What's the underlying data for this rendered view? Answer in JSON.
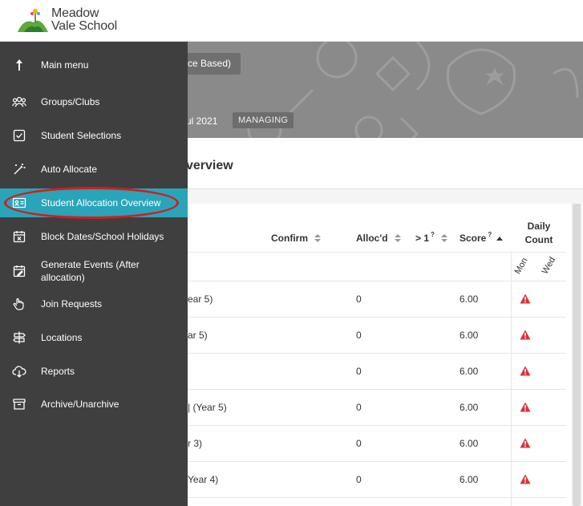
{
  "logo": {
    "line1": "Meadow",
    "line2": "Vale School"
  },
  "banner": {
    "button_label": "ce Based)",
    "date_text": "ul 2021",
    "badge": "MANAGING"
  },
  "page": {
    "title": "verview"
  },
  "table": {
    "columns": {
      "confirm": "Confirm",
      "allocd": "Alloc'd",
      "gt1": "> 1",
      "gt1_sup": "?",
      "score": "Score",
      "score_sup": "?",
      "daily": "Daily",
      "daily2": "Count"
    },
    "days": [
      "Mon",
      "Wed"
    ],
    "rows": [
      {
        "name": "ear 5)",
        "allocd": "0",
        "score": "6.00"
      },
      {
        "name": "ar 5)",
        "allocd": "0",
        "score": "6.00"
      },
      {
        "name": "",
        "allocd": "0",
        "score": "6.00"
      },
      {
        "name": "| (Year 5)",
        "allocd": "0",
        "score": "6.00"
      },
      {
        "name": "r 3)",
        "allocd": "0",
        "score": "6.00"
      },
      {
        "name": "Year 4)",
        "allocd": "0",
        "score": "6.00"
      }
    ]
  },
  "sidebar": {
    "items": [
      {
        "label": "Main menu",
        "icon": "arrow-up-icon"
      },
      {
        "label": "Groups/Clubs",
        "icon": "people-icon"
      },
      {
        "label": "Student Selections",
        "icon": "checkbox-icon"
      },
      {
        "label": "Auto Allocate",
        "icon": "magic-wand-icon"
      },
      {
        "label": "Student Allocation Overview",
        "icon": "id-card-icon"
      },
      {
        "label": "Block Dates/School Holidays",
        "icon": "calendar-x-icon"
      },
      {
        "label": "Generate Events (After",
        "label2": "allocation)",
        "icon": "calendar-edit-icon"
      },
      {
        "label": "Join Requests",
        "icon": "hand-icon"
      },
      {
        "label": "Locations",
        "icon": "signpost-icon"
      },
      {
        "label": "Reports",
        "icon": "cloud-download-icon"
      },
      {
        "label": "Archive/Unarchive",
        "icon": "archive-box-icon"
      }
    ]
  },
  "colors": {
    "accent": "#2aa4b8",
    "sidebar_bg": "#3f3f3f",
    "ring": "#d31d1d",
    "warning": "#d9303e"
  }
}
